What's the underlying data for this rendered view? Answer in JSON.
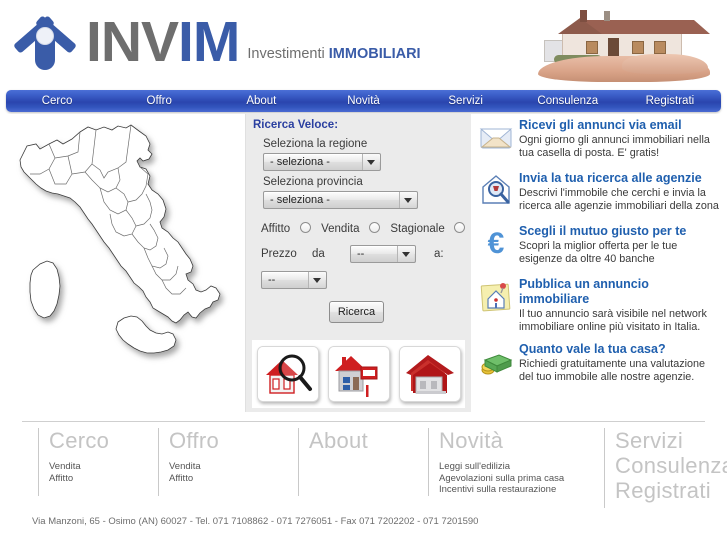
{
  "header": {
    "logo_text_gray": "INV",
    "logo_text_blue": "IM",
    "tagline_gray": "Investimenti",
    "tagline_blue": "IMMOBILIARI",
    "hero_alt": "house-in-hand"
  },
  "nav": {
    "items": [
      {
        "label": "Cerco"
      },
      {
        "label": "Offro"
      },
      {
        "label": "About"
      },
      {
        "label": "Novità"
      },
      {
        "label": "Servizi"
      },
      {
        "label": "Consulenza"
      },
      {
        "label": "Registrati"
      }
    ]
  },
  "search_form": {
    "title": "Ricerca Veloce:",
    "region_label": "Seleziona la regione",
    "region_value": "- seleziona -",
    "province_label": "Seleziona provincia",
    "province_value": "- seleziona -",
    "radio_affitto": "Affitto",
    "radio_vendita": "Vendita",
    "radio_stagionale": "Stagionale",
    "price_label": "Prezzo",
    "price_from_label": "da",
    "price_from_value": "--",
    "price_to_label": "a:",
    "price_to_value": "--",
    "submit_label": "Ricerca",
    "thumbs": [
      {
        "name": "house-search-thumb"
      },
      {
        "name": "house-for-sale-thumb"
      },
      {
        "name": "house-villa-thumb"
      }
    ]
  },
  "services": [
    {
      "icon": "envelope-icon",
      "title": "Ricevi gli annunci via email",
      "desc": "Ogni giorno gli annunci immobiliari nella tua casella di posta. E' gratis!"
    },
    {
      "icon": "house-magnifier-icon",
      "title": "Invia la tua ricerca alle agenzie",
      "desc": "Descrivi l'immobile che cerchi e invia la ricerca alle agenzie immobiliari della zona"
    },
    {
      "icon": "euro-icon",
      "title": "Scegli il mutuo giusto per te",
      "desc": "Scopri la miglior offerta per le tue esigenze da oltre 40 banche"
    },
    {
      "icon": "note-house-pin-icon",
      "title": "Pubblica un annuncio immobiliare",
      "desc": "Il tuo annuncio sarà visibile nel network immobiliare online più visitato in Italia."
    },
    {
      "icon": "money-icon",
      "title": "Quanto vale la tua casa?",
      "desc": "Richiedi gratuitamente una valutazione del tuo immobile alle nostre agenzie."
    }
  ],
  "footer": {
    "columns": [
      {
        "heading": "Cerco",
        "links": [
          "Vendita",
          "Affitto"
        ]
      },
      {
        "heading": "Offro",
        "links": [
          "Vendita",
          "Affitto"
        ]
      },
      {
        "heading": "About",
        "links": []
      },
      {
        "heading": "Novità",
        "links": [
          "Leggi sull'edilizia",
          "Agevolazioni sulla prima casa",
          "Incentivi sulla restaurazione"
        ]
      }
    ],
    "right_headings": [
      "Servizi",
      "Consulenza",
      "Registrati"
    ],
    "address": "Via Manzoni, 65 - Osimo (AN) 60027 - Tel. 071 7108862 - 071 7276051 - Fax 071 7202202 - 071 7201590"
  },
  "colors": {
    "nav_blue": "#2a45ae",
    "brand_blue": "#3a5ca8",
    "service_heading_blue": "#1f5fae",
    "form_title_blue": "#2a3fa0",
    "panel_gray": "#ebebeb",
    "footer_gray": "#c4c4c4"
  }
}
